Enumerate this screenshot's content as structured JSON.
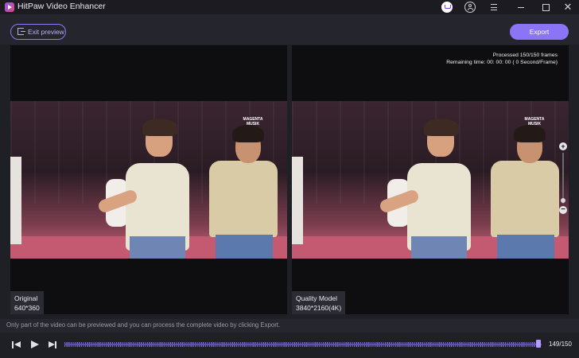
{
  "window": {
    "title": "HitPaw Video Enhancer",
    "controls": [
      "cart-icon",
      "user-icon",
      "menu-icon",
      "minimize-icon",
      "maximize-icon",
      "close-icon"
    ]
  },
  "header": {
    "exit_label": "Exit preview",
    "export_label": "Export"
  },
  "preview": {
    "left": {
      "title": "Original",
      "resolution": "640*360"
    },
    "right": {
      "title": "Quality Model",
      "resolution": "3840*2160(4K)",
      "processed": "Processed 150/150 frames",
      "remaining": "Remaining time: 00: 00: 00 ( 0 Second/Frame)"
    },
    "watermark": [
      "MAGENTA",
      "MUSIK"
    ]
  },
  "info_text": "Only part of the video can be previewed and you can process the complete video by clicking Export.",
  "playback": {
    "frame_label": "149/150",
    "current_frame": 149,
    "total_frames": 150
  },
  "colors": {
    "accent": "#8b74f5",
    "background": "#1f1f26",
    "panel": "#0e0e11"
  }
}
